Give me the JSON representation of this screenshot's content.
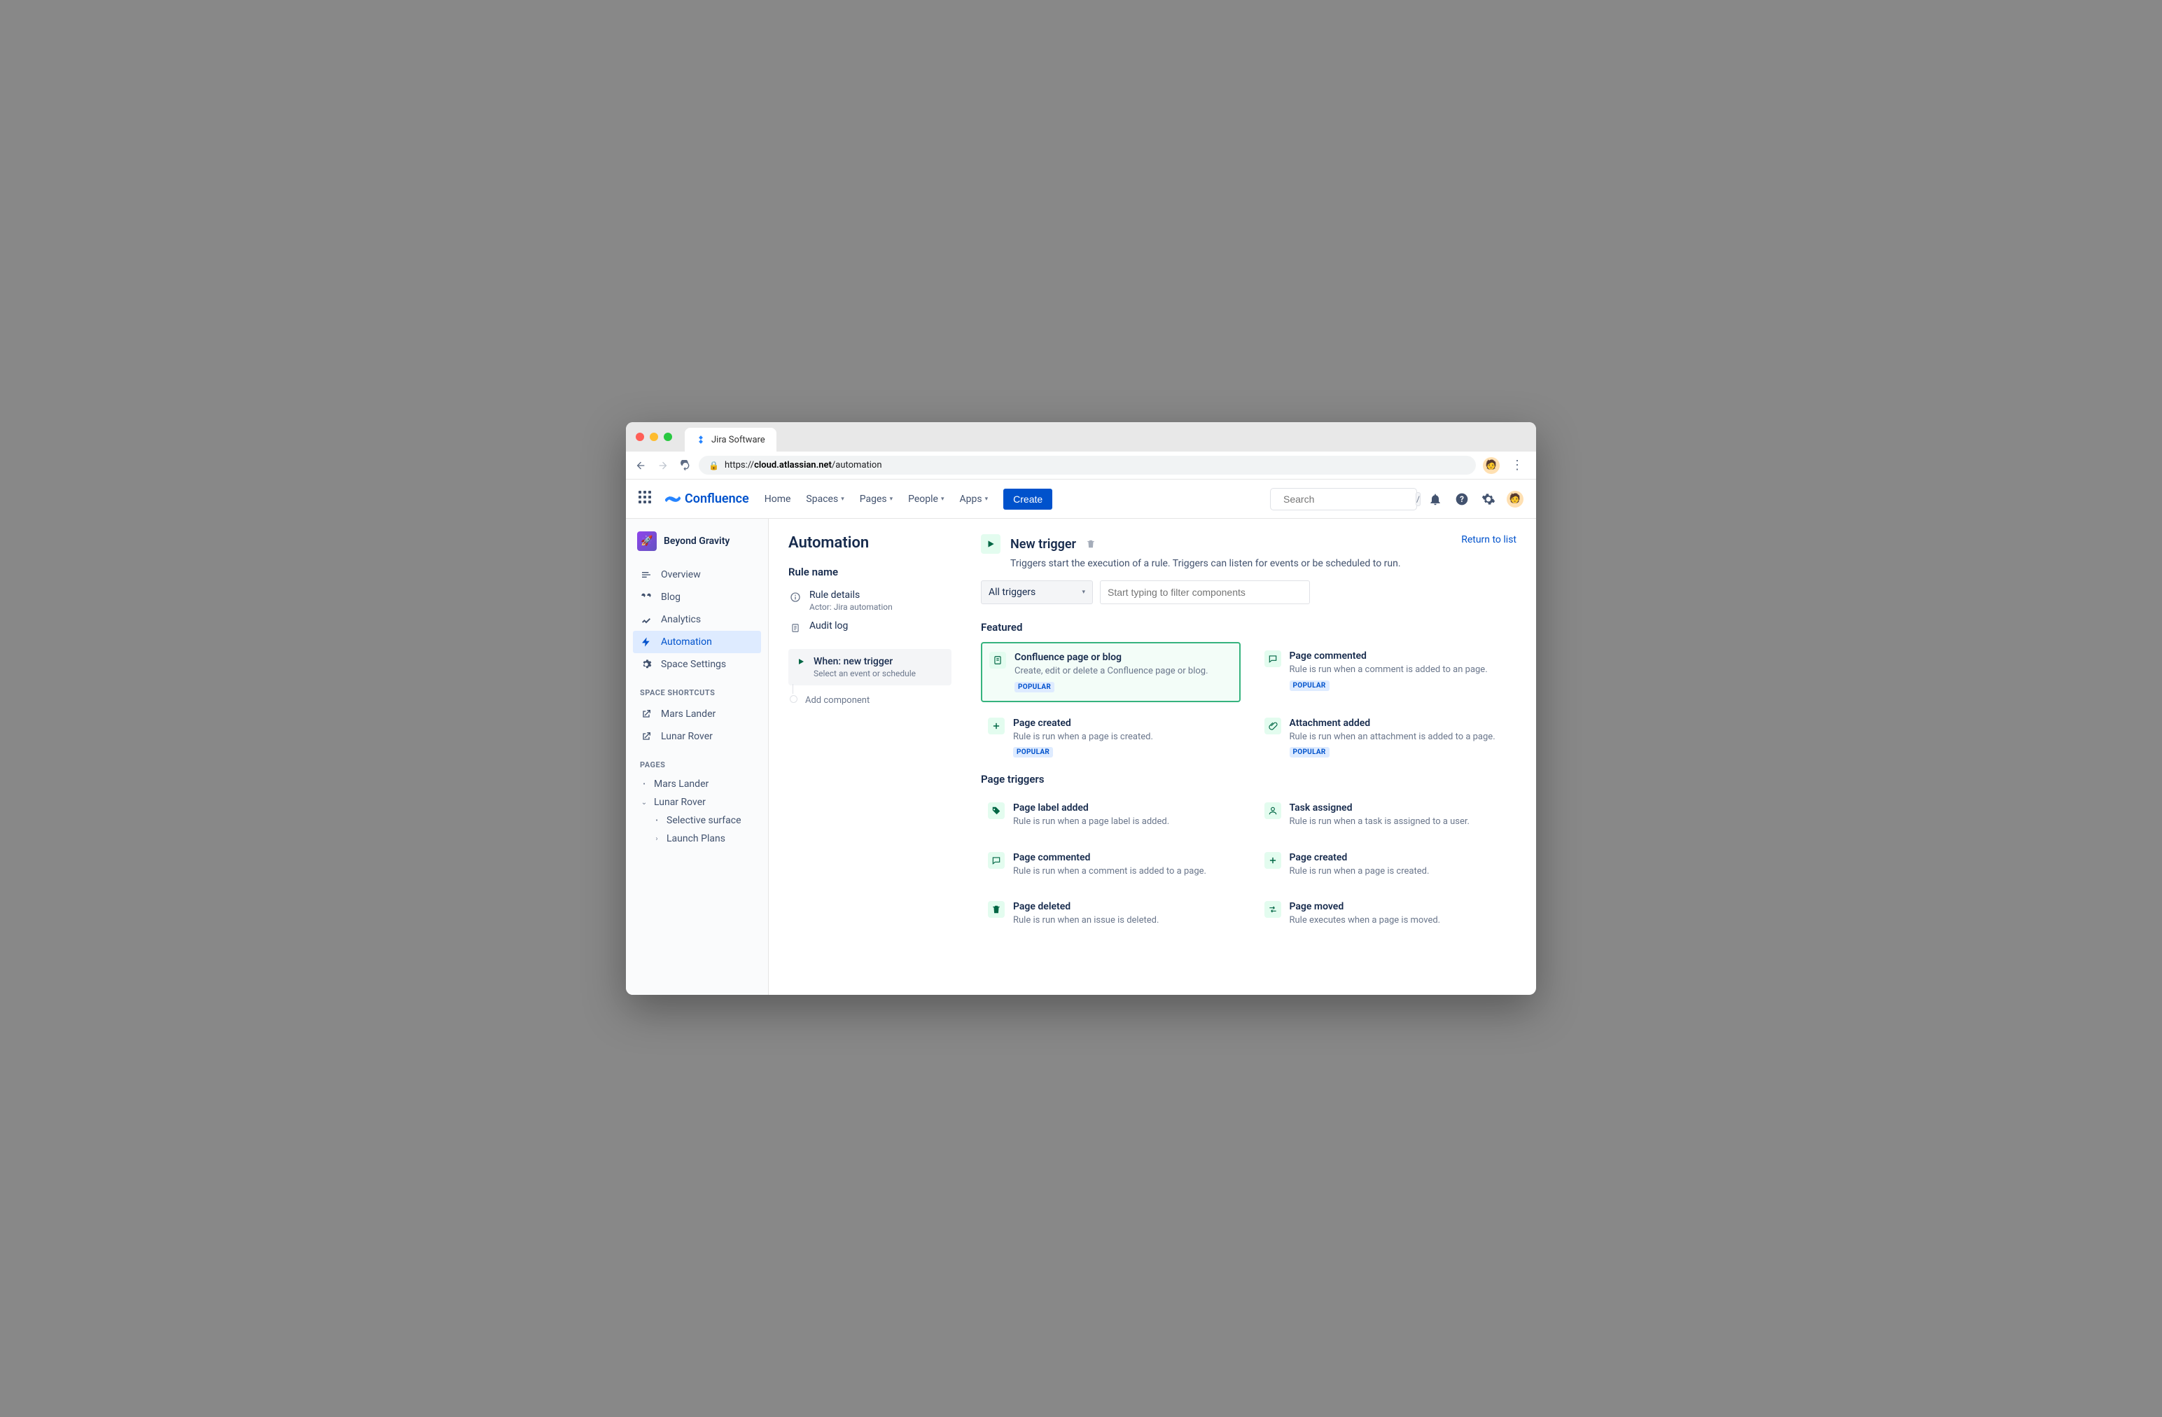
{
  "browser": {
    "tab_title": "Jira Software",
    "url_prefix": "https://",
    "url_host": "cloud.atlassian.net",
    "url_path": "/automation"
  },
  "topnav": {
    "product": "Confluence",
    "links": [
      "Home",
      "Spaces",
      "Pages",
      "People",
      "Apps"
    ],
    "create": "Create",
    "search_placeholder": "Search"
  },
  "sidebar": {
    "space_name": "Beyond Gravity",
    "items": [
      {
        "label": "Overview",
        "icon": "overview"
      },
      {
        "label": "Blog",
        "icon": "blog"
      },
      {
        "label": "Analytics",
        "icon": "analytics"
      },
      {
        "label": "Automation",
        "icon": "automation",
        "active": true
      },
      {
        "label": "Space Settings",
        "icon": "settings"
      }
    ],
    "shortcuts_label": "SPACE SHORTCUTS",
    "shortcuts": [
      "Mars Lander",
      "Lunar Rover"
    ],
    "pages_label": "PAGES",
    "pages": [
      {
        "label": "Mars Lander",
        "toggle": "bullet"
      },
      {
        "label": "Lunar Rover",
        "toggle": "open",
        "children": [
          {
            "label": "Selective surface",
            "toggle": "bullet"
          },
          {
            "label": "Launch Plans",
            "toggle": "closed"
          }
        ]
      }
    ]
  },
  "page": {
    "title": "Automation",
    "return_link": "Return to list"
  },
  "rule": {
    "section": "Rule name",
    "details_label": "Rule details",
    "details_sub": "Actor: Jira automation",
    "audit_label": "Audit log",
    "step_title": "When: new trigger",
    "step_sub": "Select an event or schedule",
    "add_component": "Add component"
  },
  "trigger": {
    "title": "New trigger",
    "description": "Triggers start the execution of a rule. Triggers can listen for events or be scheduled to run.",
    "dropdown": "All triggers",
    "filter_placeholder": "Start typing to filter components",
    "featured_label": "Featured",
    "featured": [
      {
        "title": "Confluence page or blog",
        "desc": "Create, edit or delete a Confluence page or blog.",
        "badge": "POPULAR",
        "icon": "page",
        "selected": true
      },
      {
        "title": "Page commented",
        "desc": "Rule is run when a comment is added to an page.",
        "badge": "POPULAR",
        "icon": "comment"
      },
      {
        "title": "Page created",
        "desc": "Rule is run when a page is created.",
        "badge": "POPULAR",
        "icon": "plus"
      },
      {
        "title": "Attachment added",
        "desc": "Rule is run when an attachment is added to a page.",
        "badge": "POPULAR",
        "icon": "clip"
      }
    ],
    "page_triggers_label": "Page triggers",
    "page_triggers": [
      {
        "title": "Page label added",
        "desc": "Rule is run when a page label is added.",
        "icon": "tag"
      },
      {
        "title": "Task assigned",
        "desc": "Rule is run when a task is assigned to a user.",
        "icon": "user"
      },
      {
        "title": "Page commented",
        "desc": "Rule is run when a comment is added to a page.",
        "icon": "comment"
      },
      {
        "title": "Page created",
        "desc": "Rule is run when a page is created.",
        "icon": "plus"
      },
      {
        "title": "Page deleted",
        "desc": "Rule is run when an issue is deleted.",
        "icon": "trash"
      },
      {
        "title": "Page moved",
        "desc": "Rule executes when a page is moved.",
        "icon": "move"
      }
    ]
  }
}
